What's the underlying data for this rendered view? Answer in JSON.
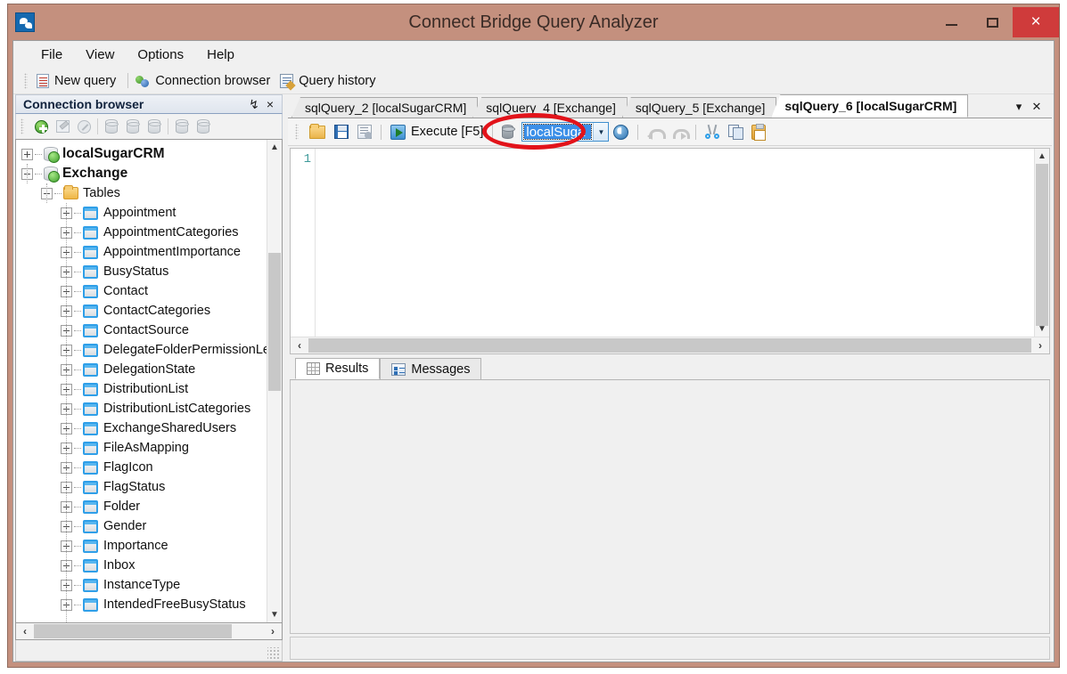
{
  "window": {
    "title": "Connect Bridge Query Analyzer",
    "app_icon": "app-logo-icon",
    "minimize_label": "—",
    "maximize_label": "❐",
    "close_label": "×",
    "accent_title_bar": "#c4907e",
    "accent_close": "#cf3b3b"
  },
  "menu": {
    "items": [
      {
        "label": "File"
      },
      {
        "label": "View"
      },
      {
        "label": "Options"
      },
      {
        "label": "Help"
      }
    ]
  },
  "app_toolbar": {
    "commands": [
      {
        "label": "New query",
        "icon": "new-query-icon"
      },
      {
        "label": "Connection browser",
        "icon": "connection-browser-icon"
      },
      {
        "label": "Query history",
        "icon": "query-history-icon"
      }
    ]
  },
  "connection_panel": {
    "title": "Connection browser",
    "pin_label": "↯",
    "close_label": "×",
    "toolbar": [
      {
        "name": "add-connection",
        "icon": "plus-circle-icon",
        "enabled": true
      },
      {
        "name": "edit-connection",
        "icon": "edit-icon",
        "enabled": false
      },
      {
        "name": "delete-connection",
        "icon": "delete-icon",
        "enabled": false
      },
      {
        "name": "connect",
        "icon": "database-connect-icon",
        "enabled": false
      },
      {
        "name": "disconnect",
        "icon": "database-icon",
        "enabled": false
      },
      {
        "name": "refresh-connection",
        "icon": "database-refresh-icon",
        "enabled": false
      },
      {
        "name": "database-properties",
        "icon": "database-props-icon",
        "enabled": false
      },
      {
        "name": "database-export",
        "icon": "database-export-icon",
        "enabled": false
      }
    ],
    "tree": [
      {
        "label": "localSugarCRM",
        "level": 0,
        "icon": "server-icon",
        "expander": "plus",
        "bold": true
      },
      {
        "label": "Exchange",
        "level": 0,
        "icon": "server-icon",
        "expander": "minus",
        "bold": true
      },
      {
        "label": "Tables",
        "level": 1,
        "icon": "folder-icon",
        "expander": "minus",
        "bold": false
      },
      {
        "label": "Appointment",
        "level": 2,
        "icon": "table-icon",
        "expander": "plus",
        "bold": false
      },
      {
        "label": "AppointmentCategories",
        "level": 2,
        "icon": "table-icon",
        "expander": "plus",
        "bold": false
      },
      {
        "label": "AppointmentImportance",
        "level": 2,
        "icon": "table-icon",
        "expander": "plus",
        "bold": false
      },
      {
        "label": "BusyStatus",
        "level": 2,
        "icon": "table-icon",
        "expander": "plus",
        "bold": false
      },
      {
        "label": "Contact",
        "level": 2,
        "icon": "table-icon",
        "expander": "plus",
        "bold": false
      },
      {
        "label": "ContactCategories",
        "level": 2,
        "icon": "table-icon",
        "expander": "plus",
        "bold": false
      },
      {
        "label": "ContactSource",
        "level": 2,
        "icon": "table-icon",
        "expander": "plus",
        "bold": false
      },
      {
        "label": "DelegateFolderPermissionLeve",
        "level": 2,
        "icon": "table-icon",
        "expander": "plus",
        "bold": false
      },
      {
        "label": "DelegationState",
        "level": 2,
        "icon": "table-icon",
        "expander": "plus",
        "bold": false
      },
      {
        "label": "DistributionList",
        "level": 2,
        "icon": "table-icon",
        "expander": "plus",
        "bold": false
      },
      {
        "label": "DistributionListCategories",
        "level": 2,
        "icon": "table-icon",
        "expander": "plus",
        "bold": false
      },
      {
        "label": "ExchangeSharedUsers",
        "level": 2,
        "icon": "table-icon",
        "expander": "plus",
        "bold": false
      },
      {
        "label": "FileAsMapping",
        "level": 2,
        "icon": "table-icon",
        "expander": "plus",
        "bold": false
      },
      {
        "label": "FlagIcon",
        "level": 2,
        "icon": "table-icon",
        "expander": "plus",
        "bold": false
      },
      {
        "label": "FlagStatus",
        "level": 2,
        "icon": "table-icon",
        "expander": "plus",
        "bold": false
      },
      {
        "label": "Folder",
        "level": 2,
        "icon": "table-icon",
        "expander": "plus",
        "bold": false
      },
      {
        "label": "Gender",
        "level": 2,
        "icon": "table-icon",
        "expander": "plus",
        "bold": false
      },
      {
        "label": "Importance",
        "level": 2,
        "icon": "table-icon",
        "expander": "plus",
        "bold": false
      },
      {
        "label": "Inbox",
        "level": 2,
        "icon": "table-icon",
        "expander": "plus",
        "bold": false
      },
      {
        "label": "InstanceType",
        "level": 2,
        "icon": "table-icon",
        "expander": "plus",
        "bold": false
      },
      {
        "label": "IntendedFreeBusyStatus",
        "level": 2,
        "icon": "table-icon",
        "expander": "plus",
        "bold": false
      }
    ],
    "scroll_up": "▲",
    "scroll_down": "▼",
    "scroll_left": "‹",
    "scroll_right": "›"
  },
  "query_tabs": {
    "tabs": [
      {
        "label": "sqlQuery_2 [localSugarCRM]",
        "active": false
      },
      {
        "label": "sqlQuery_4 [Exchange]",
        "active": false
      },
      {
        "label": "sqlQuery_5 [Exchange]",
        "active": false
      },
      {
        "label": "sqlQuery_6 [localSugarCRM]",
        "active": true
      }
    ],
    "list_label": "▾",
    "close_label": "✕"
  },
  "query_toolbar": {
    "open_label": "",
    "save_label": "",
    "save_all_label": "",
    "execute_label": "Execute [F5]",
    "connection_value": "localSuga",
    "connection_arrow": "▼",
    "icons": {
      "open": "open-file-icon",
      "save": "save-icon",
      "save_all": "save-all-icon",
      "execute": "execute-icon",
      "database": "database-icon",
      "refresh": "refresh-connection-icon",
      "undo": "undo-icon",
      "redo": "redo-icon",
      "cut": "cut-icon",
      "copy": "copy-icon",
      "paste": "paste-icon"
    },
    "annotation_color": "#e2131a"
  },
  "editor": {
    "line_numbers": [
      "1"
    ],
    "content": "",
    "scroll_up": "▲",
    "scroll_down": "▼",
    "scroll_left": "‹",
    "scroll_right": "›"
  },
  "results": {
    "tabs": [
      {
        "label": "Results",
        "icon": "grid-icon",
        "active": true
      },
      {
        "label": "Messages",
        "icon": "messages-icon",
        "active": false
      }
    ],
    "body_text": ""
  },
  "status_bar": {
    "text": ""
  }
}
